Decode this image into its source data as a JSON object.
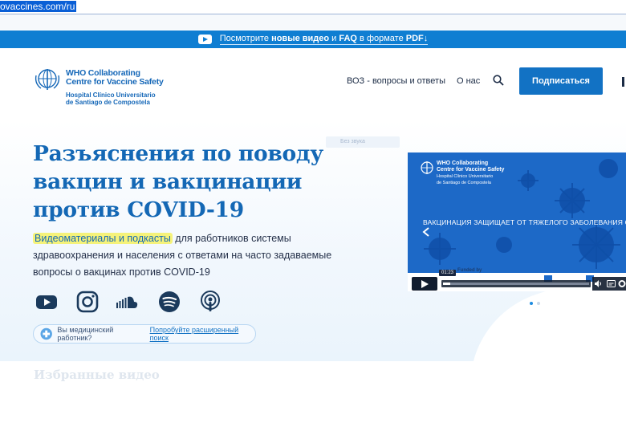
{
  "browser": {
    "url": "ovaccines.com/ru"
  },
  "announcement": {
    "before": "Посмотрите ",
    "bold1": "новые видео",
    "middle": " и ",
    "bold2": "FAQ",
    "after": " в формате ",
    "bold3": "PDF↓"
  },
  "logo": {
    "line1": "WHO Collaborating",
    "line2": "Centre for Vaccine Safety",
    "line3": "Hospital Clínico Universitario",
    "line4": "de Santiago de Compostela"
  },
  "nav": {
    "faq": "ВОЗ - вопросы и ответы",
    "about": "О нас",
    "subscribe": "Подписаться"
  },
  "hero": {
    "title": "Разъяснения по поводу вакцин и вакцинации против COVID-19",
    "highlight": "Видеоматериалы и подкасты",
    "description": " для работников системы здравоохранения и населения с ответами на часто задаваемые вопросы о вакцинах против COVID-19",
    "faded_label": "Без звука"
  },
  "social": [
    "youtube-icon",
    "instagram-icon",
    "soundcloud-icon",
    "spotify-icon",
    "podcasts-icon"
  ],
  "pill": {
    "question": "Вы медицинский работник?",
    "link": "Попробуйте расширенный поиск"
  },
  "video": {
    "logo_line1": "WHO Collaborating",
    "logo_line2": "Centre for Vaccine Safety",
    "logo_line3": "Hospital Clínico Universitario",
    "logo_line4": "de Santiago de Compostela",
    "caption": "ВАКЦИНАЦИЯ ЗАЩИЩАЕТ ОТ ТЯЖЕЛОГО ЗАБОЛЕВАНИЯ СО",
    "funded": "Funded by",
    "time": "01:23",
    "progress_fraction": 0.05
  },
  "bottom": {
    "heading": "Избранные видео"
  },
  "colors": {
    "brand": "#1272c4",
    "announce": "#0f7ed2",
    "title": "#1468b5",
    "highlight": "#f5f27a"
  }
}
